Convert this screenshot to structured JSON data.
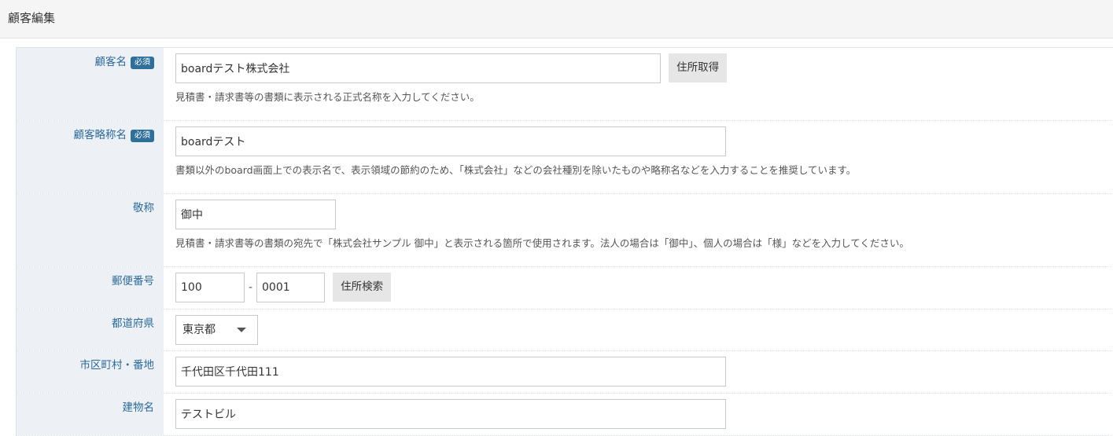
{
  "header": {
    "title": "顧客編集"
  },
  "form": {
    "required_label": "必須",
    "customer_name": {
      "label": "顧客名",
      "value": "boardテスト株式会社",
      "button": "住所取得",
      "help": "見積書・請求書等の書類に表示される正式名称を入力してください。"
    },
    "short_name": {
      "label": "顧客略称名",
      "value": "boardテスト",
      "help": "書類以外のboard画面上での表示名で、表示領域の節約のため、「株式会社」などの会社種別を除いたものや略称名などを入力することを推奨しています。"
    },
    "honorific": {
      "label": "敬称",
      "value": "御中",
      "help": "見積書・請求書等の書類の宛先で「株式会社サンプル 御中」と表示される箇所で使用されます。法人の場合は「御中」、個人の場合は「様」などを入力してください。"
    },
    "postal_code": {
      "label": "郵便番号",
      "first": "100",
      "separator": "-",
      "second": "0001",
      "button": "住所検索"
    },
    "prefecture": {
      "label": "都道府県",
      "selected": "東京都"
    },
    "address": {
      "label": "市区町村・番地",
      "value": "千代田区千代田111"
    },
    "building": {
      "label": "建物名",
      "value": "テストビル"
    }
  }
}
